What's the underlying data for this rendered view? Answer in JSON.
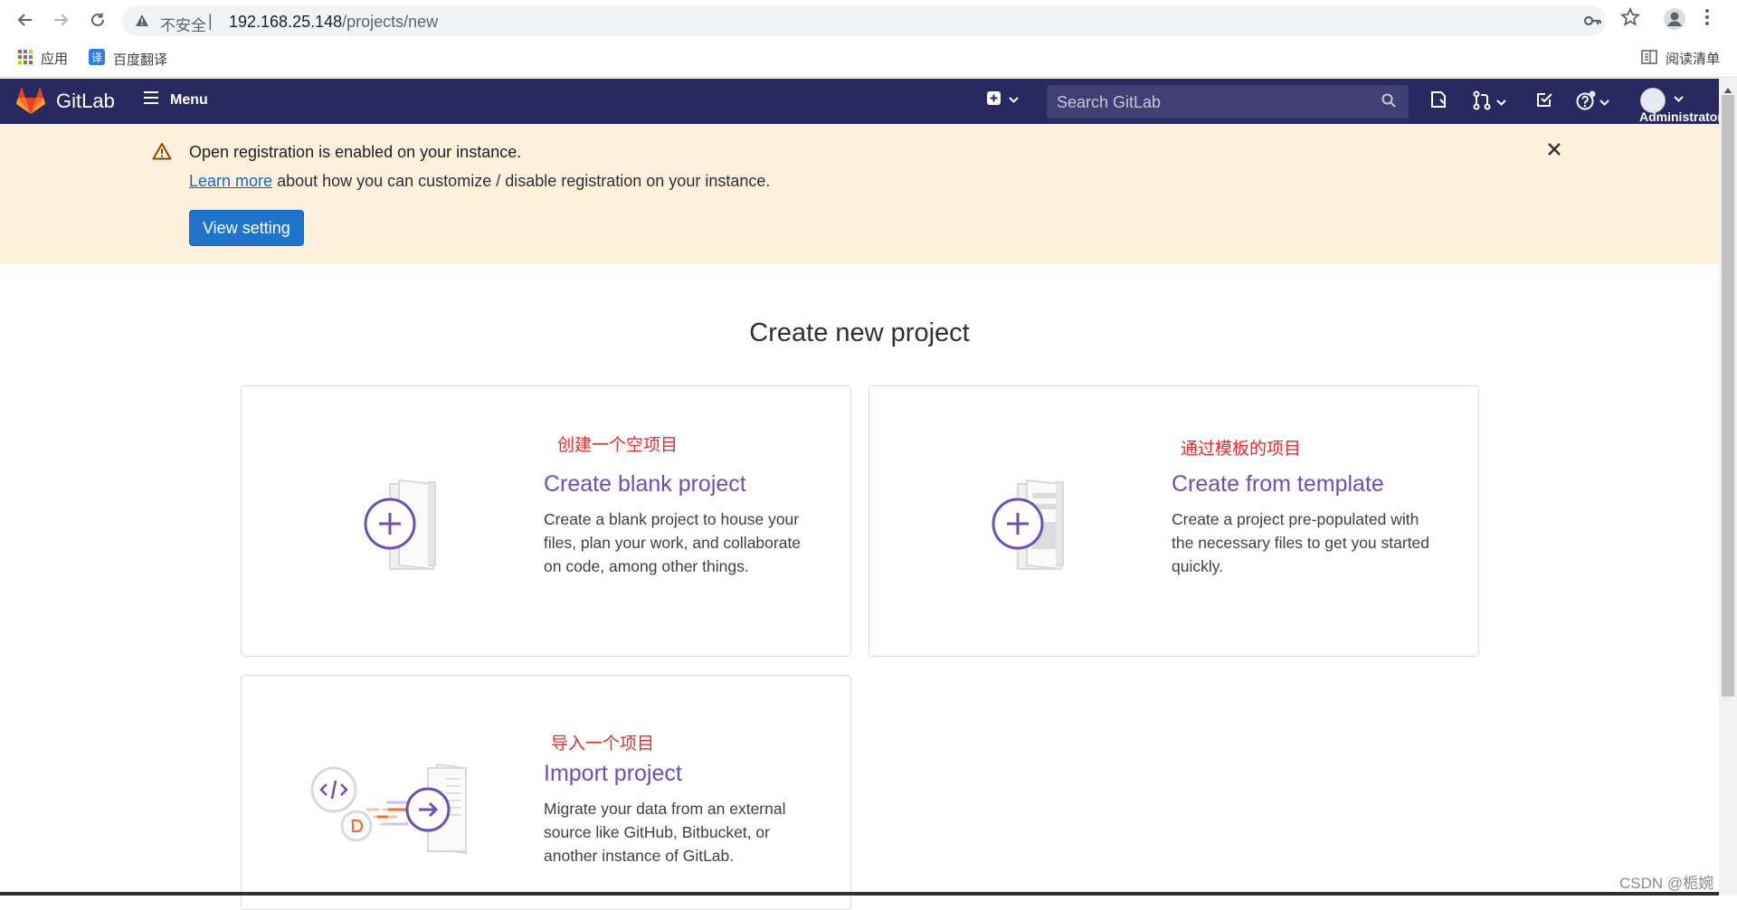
{
  "browser": {
    "insecure_label": "不安全",
    "separator": "|",
    "url_host": "192.168.25.148",
    "url_path": "/projects/new",
    "bookmarks": {
      "apps": "应用",
      "baidu_translate": "百度翻译",
      "reading_list": "阅读清单"
    }
  },
  "header": {
    "brand": "GitLab",
    "menu_label": "Menu",
    "search_placeholder": "Search GitLab",
    "user_name": "Administrator",
    "bg_color": "#292961"
  },
  "alert": {
    "title": "Open registration is enabled on your instance.",
    "link_text": "Learn more",
    "body_rest": " about how you can customize / disable registration on your instance.",
    "button_label": "View setting",
    "bg_color": "#fdf1dd"
  },
  "page": {
    "title": "Create new project",
    "cards": [
      {
        "note": "创建一个空项目",
        "title": "Create blank project",
        "description": "Create a blank project to house your files, plan your work, and collaborate on code, among other things."
      },
      {
        "note": "通过模板的项目",
        "title": "Create from template",
        "description": "Create a project pre-populated with the necessary files to get you started quickly."
      },
      {
        "note": "导入一个项目",
        "title": "Import project",
        "description": "Migrate your data from an external source like GitHub, Bitbucket, or another instance of GitLab."
      }
    ],
    "accent_color": "#6b4fbb"
  },
  "watermark": "CSDN @栀婉"
}
